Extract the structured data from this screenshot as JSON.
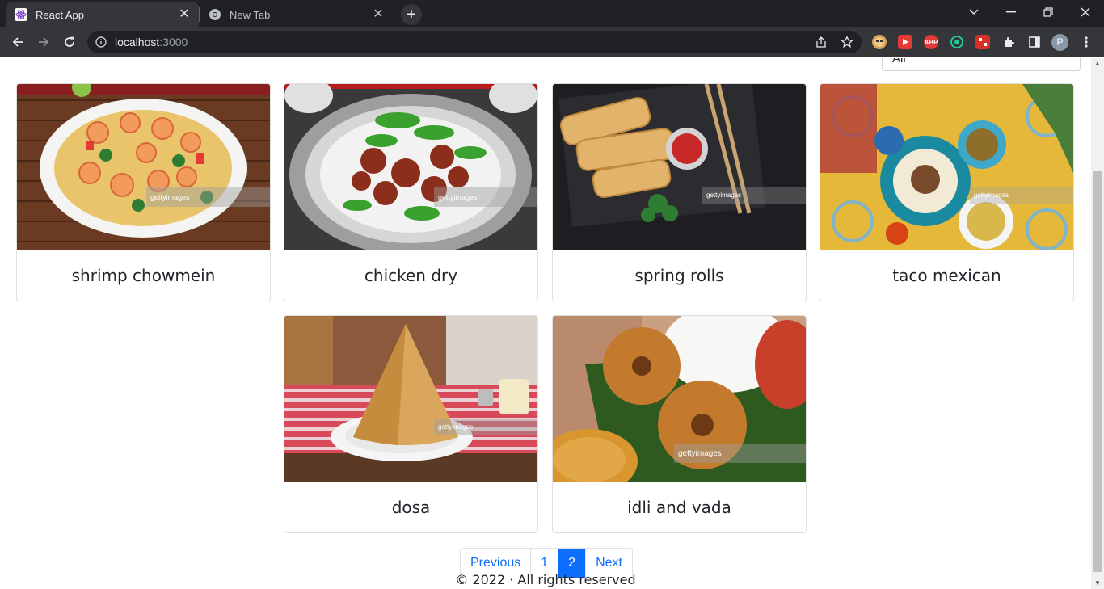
{
  "browser": {
    "tabs": [
      {
        "title": "React App",
        "active": true
      },
      {
        "title": "New Tab",
        "active": false
      }
    ],
    "address": {
      "host": "localhost",
      "port": ":3000"
    },
    "profile_initial": "P",
    "extensions": [
      "ABP"
    ]
  },
  "filter": {
    "selected": "All"
  },
  "dishes": [
    {
      "name": "shrimp chowmein"
    },
    {
      "name": "chicken dry"
    },
    {
      "name": "spring rolls"
    },
    {
      "name": "taco mexican"
    },
    {
      "name": "dosa"
    },
    {
      "name": "idli and vada"
    }
  ],
  "watermark": "gettyimages",
  "pagination": {
    "previous": "Previous",
    "pages": [
      "1",
      "2"
    ],
    "current": "2",
    "next": "Next"
  },
  "footer": {
    "text": "© 2022 · All rights reserved"
  },
  "colors": {
    "accent": "#0d6efd",
    "chrome_dark": "#202124",
    "chrome_tab": "#35363a"
  }
}
